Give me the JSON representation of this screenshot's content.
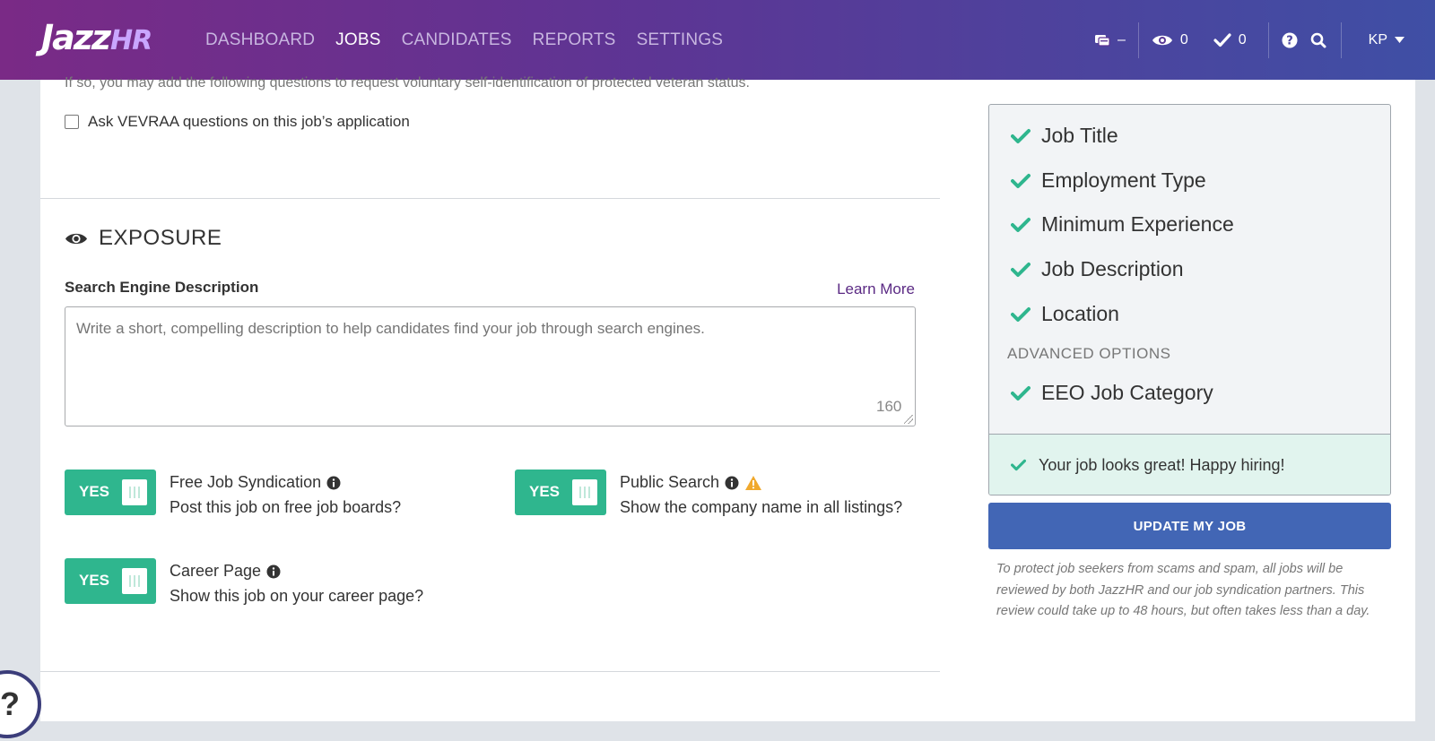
{
  "app": {
    "logo_main": "Jazz",
    "logo_accent": "HR"
  },
  "nav": {
    "items": [
      {
        "label": "DASHBOARD",
        "active": false
      },
      {
        "label": "JOBS",
        "active": true
      },
      {
        "label": "CANDIDATES",
        "active": false
      },
      {
        "label": "REPORTS",
        "active": false
      },
      {
        "label": "SETTINGS",
        "active": false
      }
    ]
  },
  "header_right": {
    "messages": {
      "icon": "messages-icon",
      "value": "–"
    },
    "watching": {
      "icon": "eye-icon",
      "value": "0"
    },
    "tasks": {
      "icon": "check-icon",
      "value": "0"
    },
    "help_icon": "help-icon",
    "search_icon": "search-icon",
    "user_initials": "KP"
  },
  "veteran": {
    "intro": "If so, you may add the following questions to request voluntary self-identification of protected veteran status.",
    "checkbox_label": "Ask VEVRAA questions on this job’s application",
    "checked": false
  },
  "exposure": {
    "title": "EXPOSURE",
    "field_label": "Search Engine Description",
    "learn_more": "Learn More",
    "placeholder": "Write a short, compelling description to help candidates find your job through search engines.",
    "char_count": "160",
    "toggles": [
      {
        "state": "YES",
        "title": "Free Job Syndication",
        "subtitle": "Post this job on free job boards?",
        "warning": false
      },
      {
        "state": "YES",
        "title": "Public Search",
        "subtitle": "Show the company name in all listings?",
        "warning": true
      },
      {
        "state": "YES",
        "title": "Career Page",
        "subtitle": "Show this job on your career page?",
        "warning": false
      }
    ]
  },
  "checklist": {
    "items": [
      "Job Title",
      "Employment Type",
      "Minimum Experience",
      "Job Description",
      "Location"
    ],
    "advanced_label": "ADVANCED OPTIONS",
    "advanced_items": [
      "EEO Job Category"
    ],
    "status": "Your job looks great! Happy hiring!"
  },
  "actions": {
    "update_label": "UPDATE MY JOB",
    "notice": "To protect job seekers from scams and spam, all jobs will be reviewed by both JazzHR and our job syndication partners. This review could take up to 48 hours, but often takes less than a day."
  },
  "help_fab": {
    "label": "?"
  },
  "colors": {
    "toggle_on": "#2fb68e",
    "check": "#2fb68e",
    "primary_button": "#4266b5",
    "link": "#5b2a84",
    "warning": "#f0a92e"
  }
}
